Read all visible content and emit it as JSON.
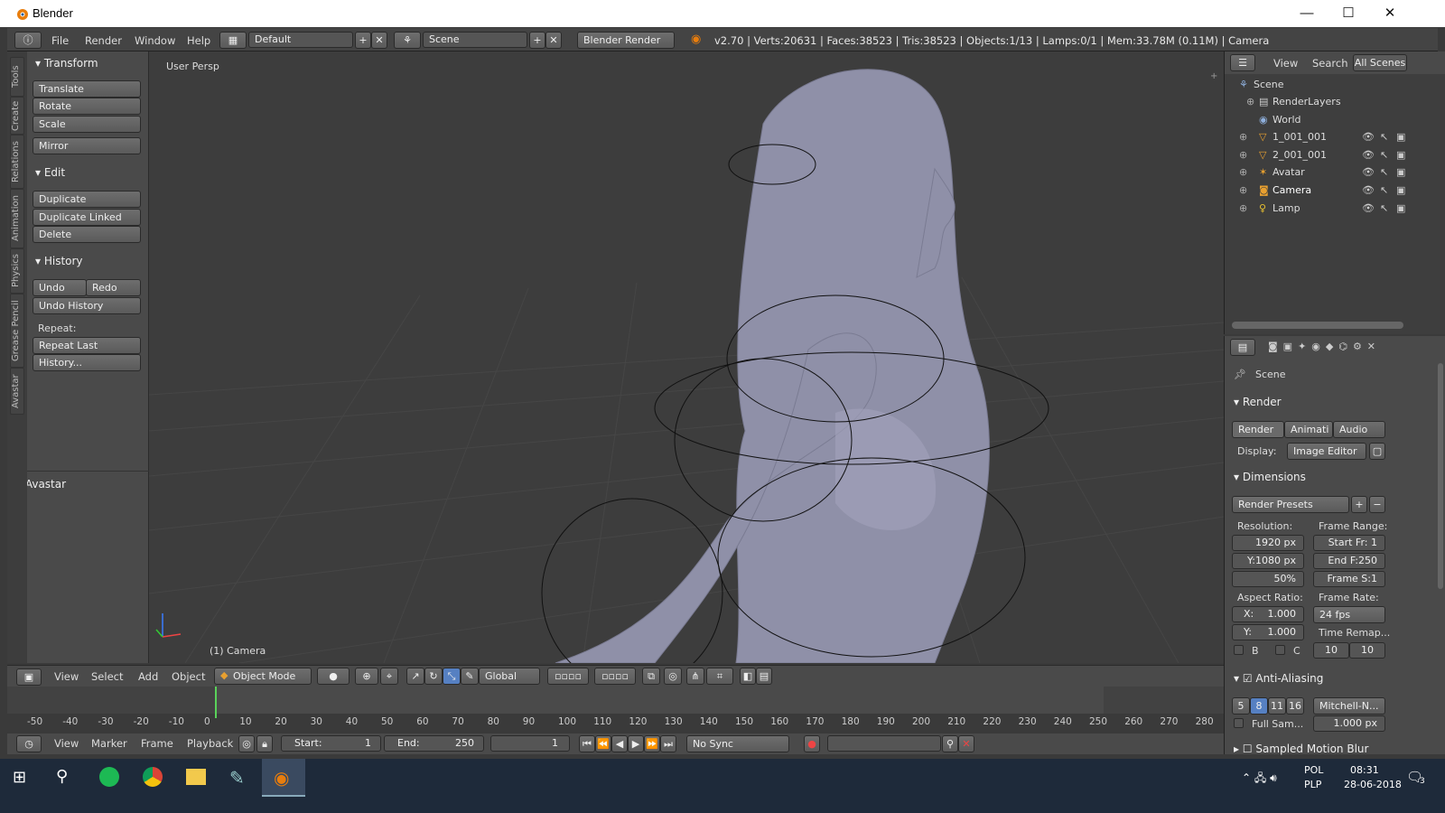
{
  "window": {
    "title": "Blender",
    "minimize": "—",
    "maximize": "☐",
    "close": "✕"
  },
  "info": {
    "menus": [
      "File",
      "Render",
      "Window",
      "Help"
    ],
    "layout": "Default",
    "scene": "Scene",
    "engine": "Blender Render",
    "stats": "v2.70 | Verts:20631 | Faces:38523 | Tris:38523 | Objects:1/13 | Lamps:0/1 | Mem:33.78M (0.11M) | Camera"
  },
  "toolshelf": {
    "tabs": [
      "Tools",
      "Create",
      "Relations",
      "Animation",
      "Physics",
      "Grease Pencil",
      "Avastar"
    ],
    "transform_header": "Transform",
    "translate": "Translate",
    "rotate": "Rotate",
    "scale": "Scale",
    "mirror": "Mirror",
    "edit_header": "Edit",
    "duplicate": "Duplicate",
    "duplicate_linked": "Duplicate Linked",
    "delete": "Delete",
    "history_header": "History",
    "undo": "Undo",
    "redo": "Redo",
    "undo_history": "Undo History",
    "repeat_label": "Repeat:",
    "repeat_last": "Repeat Last",
    "history_btn": "History...",
    "avastar_header": "Avastar"
  },
  "viewport": {
    "view_name": "User Persp",
    "object_label": "(1) Camera"
  },
  "vheader": {
    "menus": [
      "View",
      "Select",
      "Add",
      "Object"
    ],
    "mode": "Object Mode",
    "orientation": "Global"
  },
  "timeline": {
    "ticks": [
      "-50",
      "-40",
      "-30",
      "-20",
      "-10",
      "0",
      "10",
      "20",
      "30",
      "40",
      "50",
      "60",
      "70",
      "80",
      "90",
      "100",
      "110",
      "120",
      "130",
      "140",
      "150",
      "160",
      "170",
      "180",
      "190",
      "200",
      "210",
      "220",
      "230",
      "240",
      "250",
      "260",
      "270",
      "280"
    ]
  },
  "tlheader": {
    "menus": [
      "View",
      "Marker",
      "Frame",
      "Playback"
    ],
    "start_label": "Start:",
    "start": "1",
    "end_label": "End:",
    "end": "250",
    "current": "1",
    "sync": "No Sync"
  },
  "outliner": {
    "menus": [
      "View",
      "Search"
    ],
    "filter": "All Scenes",
    "scene": "Scene",
    "items": [
      "RenderLayers",
      "World",
      "1_001_001",
      "2_001_001",
      "Avatar",
      "Camera",
      "Lamp"
    ]
  },
  "props": {
    "context": "Scene",
    "render_header": "Render",
    "render_btn": "Render",
    "anim_btn": "Animati",
    "audio_btn": "Audio",
    "display_label": "Display:",
    "display_value": "Image Editor",
    "dimensions_header": "Dimensions",
    "presets": "Render Presets",
    "resolution_label": "Resolution:",
    "res_x": "1920 px",
    "res_y": "Y:1080 px",
    "res_pct": "50%",
    "frame_range_label": "Frame Range:",
    "start_fr": "Start Fr: 1",
    "end_fr": "End F:250",
    "frame_step": "Frame S:1",
    "aspect_label": "Aspect Ratio:",
    "asp_x": "1.000",
    "asp_x_lbl": "X:",
    "asp_y": "1.000",
    "asp_y_lbl": "Y:",
    "frame_rate_label": "Frame Rate:",
    "fps": "24 fps",
    "time_remap": "Time Remap...",
    "b_label": "B",
    "c_label": "C",
    "remap_old": "10",
    "remap_new": "10",
    "aa_header": "Anti-Aliasing",
    "aa_samples": [
      "5",
      "8",
      "11",
      "16"
    ],
    "filter": "Mitchell-N...",
    "full_sample": "Full Sam...",
    "filter_size": "1.000 px",
    "motion_blur": "Sampled Motion Blur"
  },
  "taskbar": {
    "lang1": "POL",
    "lang2": "PLP",
    "time": "08:31",
    "date": "28-06-2018",
    "notifications": "3"
  }
}
